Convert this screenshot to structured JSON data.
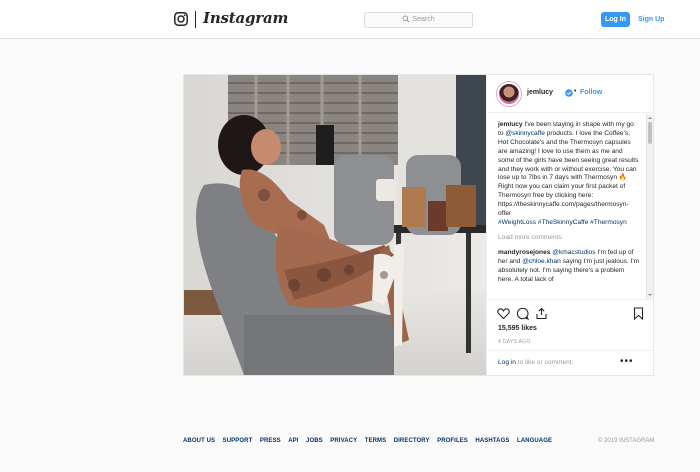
{
  "header": {
    "logo_text": "Instagram",
    "search_placeholder": "Search",
    "login_label": "Log In",
    "signup_label": "Sign Up"
  },
  "post": {
    "username": "jemlucy",
    "follow_label": "Follow",
    "caption": {
      "user": "jemlucy",
      "text_1": " I've been staying in shape with my go to ",
      "mention": "@skinnycaffe",
      "text_2": " products. I love the Coffee's, Hot Chocolate's and the Thermosyn capsules are amazing! I love to use them as me and some of the girls have been seeing great results and they work with or without exercise. You can lose up to 7lbs in 7 days with Thermosyn 🔥 Right now you can claim your first packet of Thermosyn free by clicking here: https://theskinnycaffe.com/pages/thermosyn-offer",
      "hashtags": "#WeightLoss #TheSkinnyCaffe #Thermosyn"
    },
    "load_more": "Load more comments",
    "comment": {
      "user": "mandyrosejones",
      "mention_1": "@kmacstudios",
      "text_1": " I'm fed up of her and ",
      "mention_2": "@chloe.khan",
      "text_2": " saying I'm just jealous. I'm absolutely not. I'm saying there's a problem here. A total lack of"
    },
    "likes": "15,595 likes",
    "time_ago": "4 DAYS AGO",
    "login_prompt": {
      "link": "Log in",
      "text": " to like or comment."
    },
    "more_label": "•••"
  },
  "icons": {
    "like": "heart-icon",
    "comment": "comment-icon",
    "share": "share-icon",
    "save": "bookmark-icon",
    "verified": "verified-badge-icon"
  },
  "colors": {
    "accent": "#3897f0",
    "link": "#003569",
    "muted": "#999999",
    "text": "#262626",
    "background": "#fafafa"
  },
  "footer": {
    "links": [
      "ABOUT US",
      "SUPPORT",
      "PRESS",
      "API",
      "JOBS",
      "PRIVACY",
      "TERMS",
      "DIRECTORY",
      "PROFILES",
      "HASHTAGS",
      "LANGUAGE"
    ],
    "copyright": "© 2019 INSTAGRAM"
  }
}
